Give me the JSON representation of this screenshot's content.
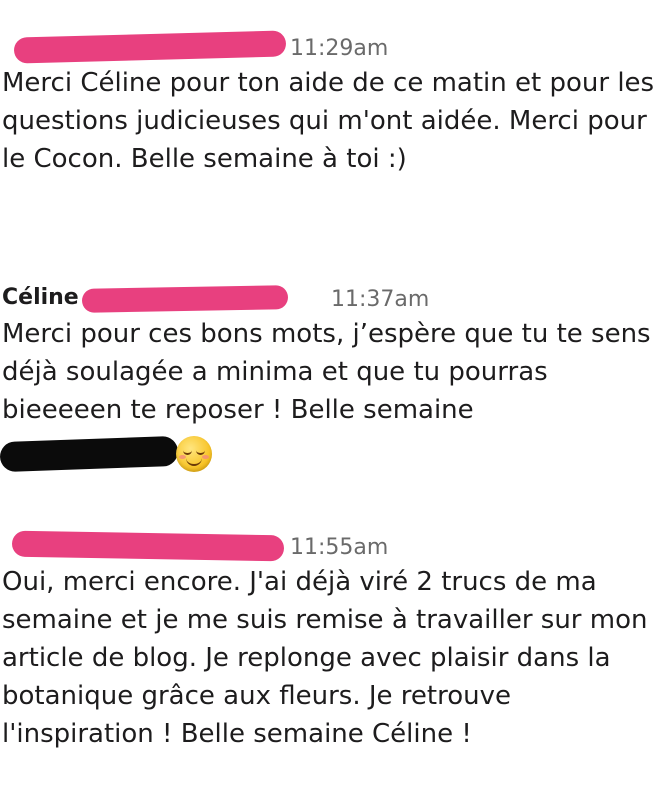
{
  "messages": [
    {
      "sender": "",
      "time": "11:29am",
      "text": "Merci Céline pour ton aide de ce matin et pour les questions judicieuses qui m'ont aidée. Merci pour le Cocon. Belle semaine à toi :)"
    },
    {
      "sender": "Céline",
      "time": "11:37am",
      "text": "Merci pour ces bons mots, j’espère que tu te sens déjà soulagée a minima et que tu pourras bieeeeen te reposer ! Belle semaine",
      "emoji": "smiling-face-emoji"
    },
    {
      "sender": "",
      "time": "11:55am",
      "text": "Oui, merci encore. J'ai déjà viré 2 trucs de ma semaine et je me suis remise à travailler sur mon article de blog. Je replonge avec plaisir dans la botanique grâce aux fleurs. Je retrouve l'inspiration ! Belle semaine Céline !"
    }
  ],
  "colors": {
    "redaction_pink": "#e8407f",
    "redaction_black": "#0b0b0b",
    "time": "#6a6a6a",
    "text": "#1d1c1d"
  }
}
